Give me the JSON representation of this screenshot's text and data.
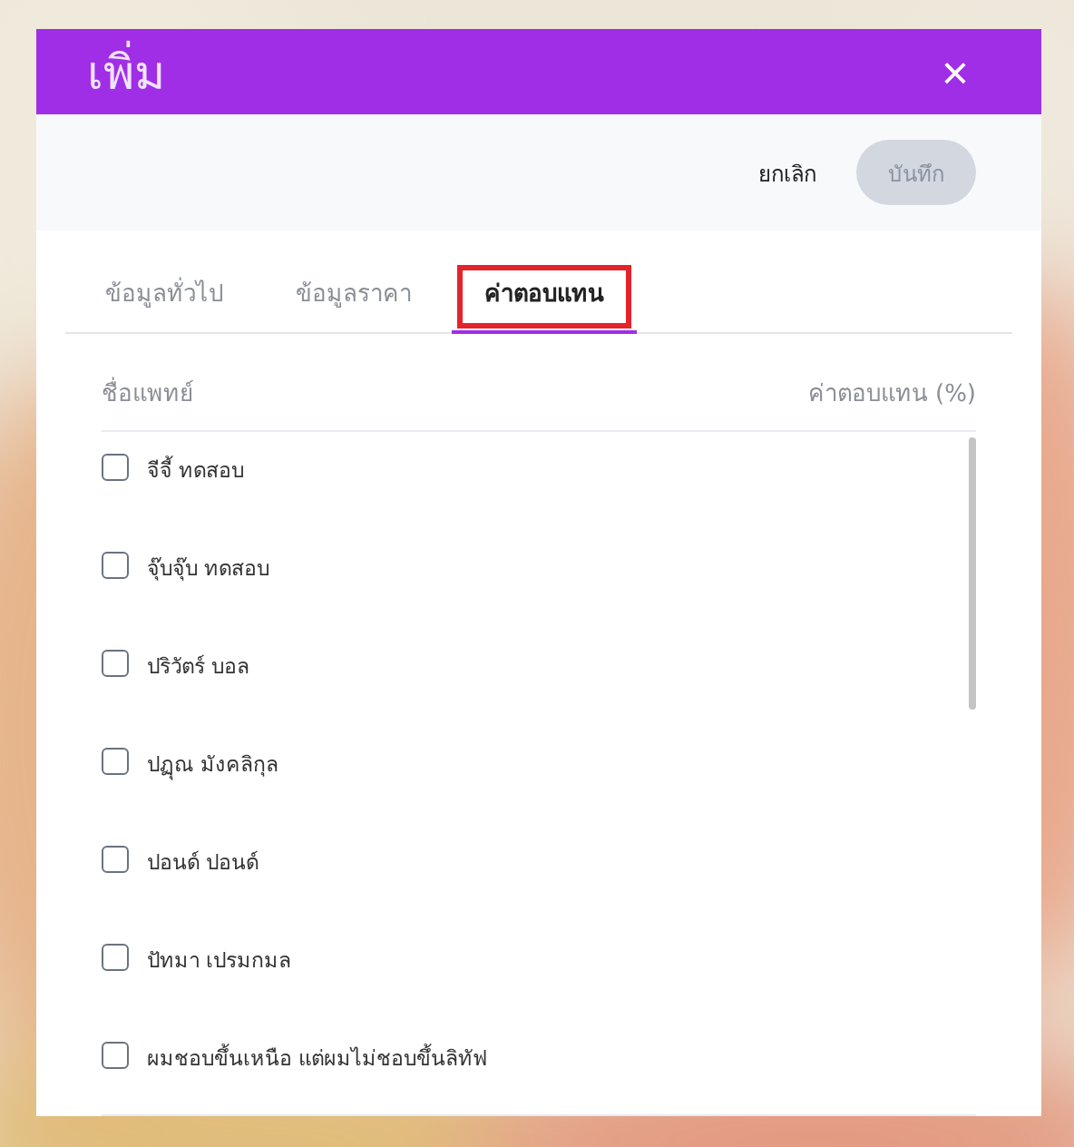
{
  "dialog": {
    "title": "เพิ่ม",
    "close": "×"
  },
  "toolbar": {
    "cancel": "ยกเลิก",
    "save": {
      "label": "บันทึก",
      "disabled": true
    }
  },
  "tabs": [
    {
      "label": "ข้อมูลทั่วไป",
      "selected": false,
      "highlighted": false
    },
    {
      "label": "ข้อมูลราคา",
      "selected": false,
      "highlighted": false
    },
    {
      "label": "ค่าตอบแทน",
      "selected": true,
      "highlighted": true
    }
  ],
  "table": {
    "columns": [
      "ชื่อแพทย์",
      "ค่าตอบแทน (%)"
    ],
    "rows": [
      {
        "name": "จีจี้ ทดสอบ",
        "checked": false
      },
      {
        "name": "จุ๊บจุ๊บ ทดสอบ",
        "checked": false
      },
      {
        "name": "ปริวัตร์ บอล",
        "checked": false
      },
      {
        "name": "ปฏุณ มังคลิกุล",
        "checked": false
      },
      {
        "name": "ปอนด์ ปอนด์",
        "checked": false
      },
      {
        "name": "ปัทมา เปรมกมล",
        "checked": false
      },
      {
        "name": "ผมชอบขึ้นเหนือ แต่ผมไม่ชอบขึ้นลิทัฟ",
        "checked": false
      }
    ]
  }
}
